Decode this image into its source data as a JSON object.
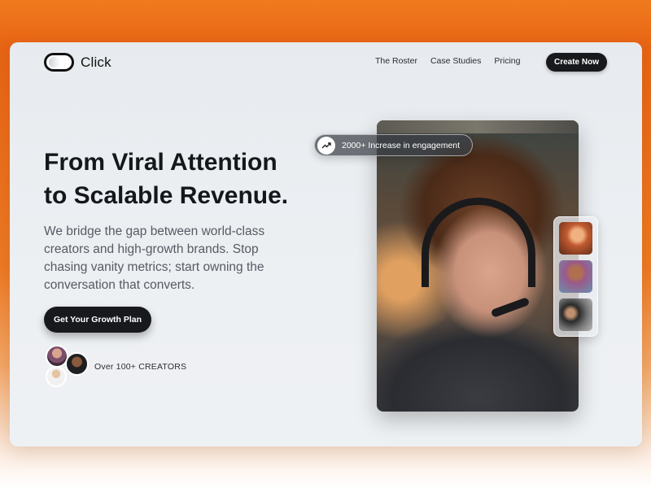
{
  "header": {
    "brand": "Click",
    "nav": [
      "The Roster",
      "Case Studies",
      "Pricing"
    ],
    "cta": "Create Now"
  },
  "hero": {
    "title_line1": "From Viral Attention",
    "title_line2": "to Scalable Revenue.",
    "subtitle": "We bridge the gap between world-class creators and high-growth brands. Stop chasing vanity metrics; start owning the conversation that converts.",
    "cta": "Get Your Growth Plan",
    "creators_label": "Over 100+ CREATORS"
  },
  "media": {
    "engagement_badge": "2000+ Increase in engagement",
    "engagement_icon": "trending-up-icon"
  },
  "colors": {
    "accent": "#e86414",
    "button_dark": "#17191c"
  }
}
